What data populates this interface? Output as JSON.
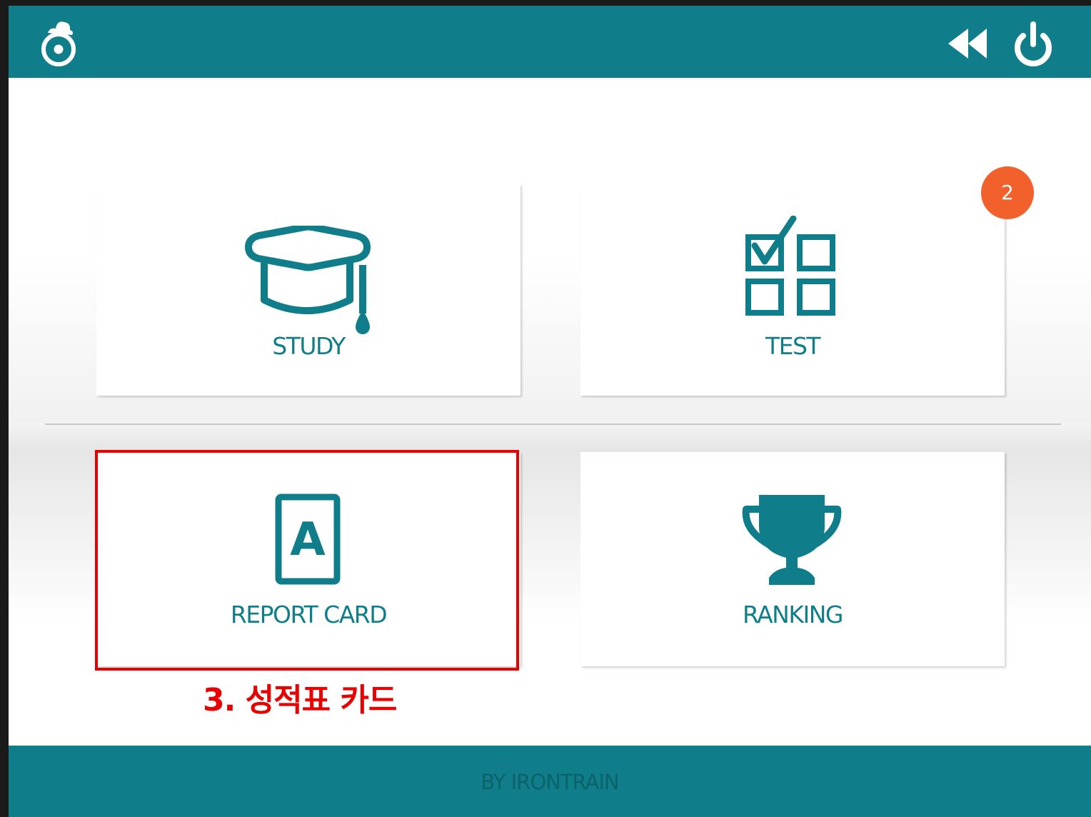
{
  "header": {
    "logo_icon": "app-logo-icon",
    "back_icon": "rewind-icon",
    "power_icon": "power-icon"
  },
  "menu": {
    "study": {
      "label": "STUDY",
      "icon": "graduation-cap-icon"
    },
    "test": {
      "label": "TEST",
      "icon": "checklist-grid-icon",
      "badge": "2"
    },
    "report_card": {
      "label": "REPORT CARD",
      "icon": "grade-a-card-icon"
    },
    "ranking": {
      "label": "RANKING",
      "icon": "trophy-icon"
    }
  },
  "annotation": {
    "text": "3. 성적표 카드"
  },
  "footer": {
    "text": "BY IRONTRAIN"
  },
  "colors": {
    "brand": "#107e8a",
    "badge": "#f2602c",
    "annotation": "#e90000"
  }
}
